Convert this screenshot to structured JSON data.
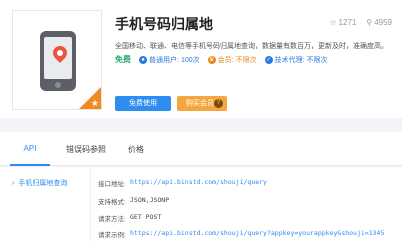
{
  "product": {
    "title": "手机号码归属地",
    "likes": "1271",
    "views": "4959",
    "description": "全国移动、联通、电信等手机号码归属地查询，数据量有数百万，更新及时，准确度高。",
    "free_label": "免费",
    "tags": [
      {
        "icon": "user-icon",
        "label": "普通用户:",
        "value": "100次",
        "color": "#2a7ae2"
      },
      {
        "icon": "vip-icon",
        "label": "会员:",
        "value": "不限次",
        "color": "#e88a1a"
      },
      {
        "icon": "tech-support-icon",
        "label": "技术代理:",
        "value": "不限次",
        "color": "#2a7ae2"
      }
    ],
    "free_button": "免费使用",
    "vip_button": "购买会员",
    "vip_help": "?"
  },
  "tabs": [
    "API",
    "错误码参照",
    "价格"
  ],
  "sidebar": {
    "item": "手机归属地查询"
  },
  "api": {
    "rows": [
      {
        "label": "接口地址:",
        "value": "https://api.binstd.com/shouji/query"
      },
      {
        "label": "支持格式:",
        "value": "JSON,JSONP"
      },
      {
        "label": "请求方法:",
        "value": "GET POST"
      },
      {
        "label": "请求示例:",
        "value": "https://api.binstd.com/shouji/query?appkey=yourappkey&shouji=1345"
      }
    ]
  },
  "colors": {
    "accent": "#2f8cf0",
    "vip": "#f4a73d",
    "free": "#2aa872",
    "marker": "#e8563f"
  }
}
